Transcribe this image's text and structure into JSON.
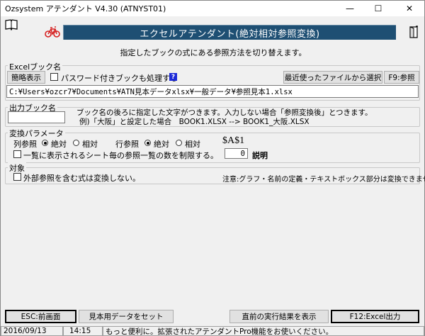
{
  "window": {
    "title": "Ozsystem アテンダント V4.30 (ATNYST01)",
    "minimize": "—",
    "maximize": "☐",
    "close": "✕"
  },
  "header": {
    "banner": "エクセルアテンダント(絶対相対参照変換)",
    "subtitle": "指定したブックの式にある参照方法を切り替えます。"
  },
  "excel_book": {
    "group_label": "Excelブック名",
    "brief_button": "簡略表示",
    "password_label": "パスワード付きブックも処理する",
    "password_checked": false,
    "help_icon": "?",
    "recent_button": "最近使ったファイルから選択",
    "browse_button": "F9:参照",
    "path_value": "C:¥Users¥ozcr7¥Documents¥ATN見本データxlsx¥一般データ¥参照見本1.xlsx"
  },
  "output_book": {
    "group_label": "出力ブック名",
    "suffix_value": "",
    "note_line1": "ブック名の後ろに指定した文字がつきます。入力しない場合「参照変換後」とつきます。",
    "note_line2": "例)「大阪」と設定した場合　BOOK1.XLSX --> BOOK1_大阪.XLSX"
  },
  "params": {
    "group_label": "変換パラメータ",
    "col_ref_label": "列参照",
    "col_absolute": "絶対",
    "col_relative": "相対",
    "col_selected": "absolute",
    "row_ref_label": "行参照",
    "row_absolute": "絶対",
    "row_relative": "相対",
    "row_selected": "absolute",
    "preview": "$A$1",
    "limit_label": "一覧に表示されるシート毎の参照一覧の数を制限する。",
    "limit_checked": false,
    "limit_value": "0",
    "explain": "説明"
  },
  "target": {
    "group_label": "対象",
    "external_label": "外部参照を含む式は変換しない。",
    "external_checked": false,
    "note": "注意:グラフ・名前の定義・テキストボックス部分は変換できません。"
  },
  "footer": {
    "esc_button": "ESC:前画面",
    "sample_button": "見本用データをセット",
    "last_result_button": "直前の実行結果を表示",
    "run_button": "F12:Excel出力"
  },
  "statusbar": {
    "date": "2016/09/13",
    "time": "14:15",
    "message": "もっと便利に。拡張されたアテンダントPro機能をお使いください。"
  },
  "colors": {
    "banner_bg": "#1e4f73",
    "banner_text": "#ffffff",
    "help_icon_bg": "#1c2ad8",
    "bike_icon": "#d62020"
  }
}
